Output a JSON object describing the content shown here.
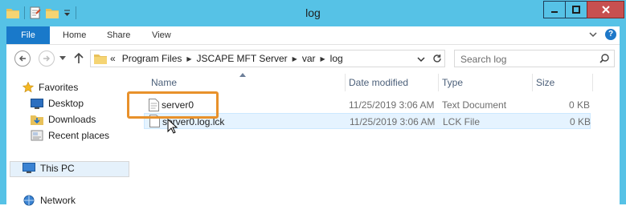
{
  "window": {
    "title": "log"
  },
  "ribbon": {
    "tabs": [
      {
        "label": "File"
      },
      {
        "label": "Home"
      },
      {
        "label": "Share"
      },
      {
        "label": "View"
      }
    ]
  },
  "address": {
    "overflow": "«",
    "crumbs": [
      {
        "label": "Program Files"
      },
      {
        "label": "JSCAPE MFT Server"
      },
      {
        "label": "var"
      },
      {
        "label": "log"
      }
    ]
  },
  "search": {
    "placeholder": "Search log"
  },
  "nav": {
    "favorites": "Favorites",
    "items": [
      {
        "label": "Desktop"
      },
      {
        "label": "Downloads"
      },
      {
        "label": "Recent places"
      }
    ],
    "this_pc": "This PC",
    "network": "Network"
  },
  "columns": {
    "name": "Name",
    "date": "Date modified",
    "type": "Type",
    "size": "Size"
  },
  "files": [
    {
      "name": "server0",
      "date": "11/25/2019 3:06 AM",
      "type": "Text Document",
      "size": "0 KB"
    },
    {
      "name": "server0.log.lck",
      "date": "11/25/2019 3:06 AM",
      "type": "LCK File",
      "size": "0 KB"
    }
  ],
  "colors": {
    "accent": "#1979ca",
    "highlight": "#e8912b",
    "titlebar": "#56c2e6"
  }
}
